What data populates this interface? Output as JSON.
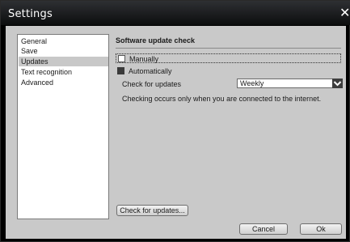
{
  "window": {
    "title": "Settings",
    "close_glyph": "✕"
  },
  "sidebar": {
    "items": [
      {
        "label": "General",
        "selected": false
      },
      {
        "label": "Save",
        "selected": false
      },
      {
        "label": "Updates",
        "selected": true
      },
      {
        "label": "Text recognition",
        "selected": false
      },
      {
        "label": "Advanced",
        "selected": false
      }
    ]
  },
  "updates": {
    "section_title": "Software update check",
    "options": [
      {
        "label": "Manually",
        "checked": false
      },
      {
        "label": "Automatically",
        "checked": true
      }
    ],
    "frequency_label": "Check for updates",
    "frequency_value": "Weekly",
    "note": "Checking occurs only when you are connected to the internet.",
    "check_now_label": "Check for updates..."
  },
  "footer": {
    "cancel_label": "Cancel",
    "ok_label": "Ok"
  },
  "colors": {
    "titlebar": "#0c0d0e",
    "panel": "#c9c9c9",
    "selected_item": "#c8c8c8"
  },
  "icons": {
    "close": "close-icon",
    "dropdown": "chevron-down-icon"
  }
}
